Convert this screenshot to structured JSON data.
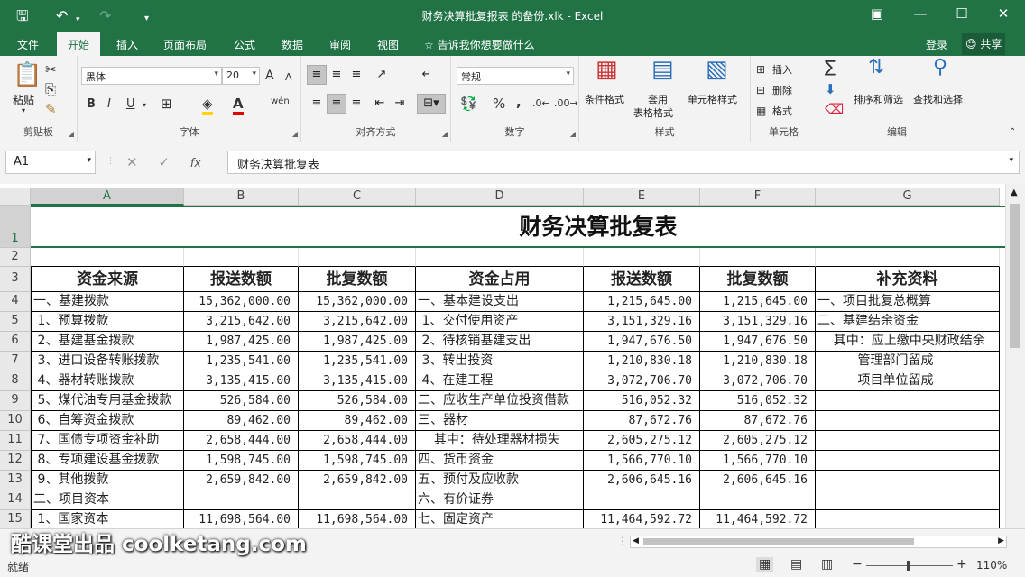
{
  "window": {
    "title": "财务决算批复报表 的备份.xlk - Excel"
  },
  "quick_access": {
    "save_icon": "save-icon",
    "undo_icon": "undo-icon",
    "redo_icon": "redo-icon",
    "customize_icon": "customize-icon"
  },
  "window_controls": {
    "restore_ribbon": "ribbon-display-icon",
    "min": "minimize-icon",
    "max": "maximize-icon",
    "close": "close-icon"
  },
  "tabs": [
    "文件",
    "开始",
    "插入",
    "页面布局",
    "公式",
    "数据",
    "审阅",
    "视图"
  ],
  "active_tab": "开始",
  "tell_me": "告诉我你想要做什么",
  "login": "登录",
  "share": "共享",
  "ribbon": {
    "clipboard": {
      "paste": "粘贴",
      "label": "剪贴板"
    },
    "font": {
      "name": "黑体",
      "size": "20",
      "bold": "B",
      "italic": "I",
      "underline": "U",
      "label": "字体",
      "grow": "A",
      "shrink": "A",
      "pinyin": "wén"
    },
    "alignment": {
      "label": "对齐方式"
    },
    "number": {
      "format": "常规",
      "label": "数字",
      "percent": "%",
      "comma": ","
    },
    "styles": {
      "cond": "条件格式",
      "table": "套用",
      "table2": "表格格式",
      "cell": "单元格样式",
      "label": "样式"
    },
    "cells": {
      "insert": "插入",
      "delete": "删除",
      "format": "格式",
      "label": "单元格"
    },
    "editing": {
      "sort": "排序和筛选",
      "find": "查找和选择",
      "label": "编辑"
    }
  },
  "formula_bar": {
    "name_box": "A1",
    "fx": "fx",
    "content": "财务决算批复表"
  },
  "columns": [
    "A",
    "B",
    "C",
    "D",
    "E",
    "F",
    "G"
  ],
  "rows": [
    "1",
    "2",
    "3",
    "4",
    "5",
    "6",
    "7",
    "8",
    "9",
    "10",
    "11",
    "12",
    "13",
    "14",
    "15"
  ],
  "sheet": {
    "title": "财务决算批复表",
    "headers": [
      "资金来源",
      "报送数额",
      "批复数额",
      "资金占用",
      "报送数额",
      "批复数额",
      "补充资料"
    ],
    "data": [
      [
        "一、基建拨款",
        "15,362,000.00",
        "15,362,000.00",
        "一、基本建设支出",
        "1,215,645.00",
        "1,215,645.00",
        "一、项目批复总概算"
      ],
      [
        " 1、预算拨款",
        "3,215,642.00",
        "3,215,642.00",
        " 1、交付使用资产",
        "3,151,329.16",
        "3,151,329.16",
        "二、基建结余资金"
      ],
      [
        " 2、基建基金拨款",
        "1,987,425.00",
        "1,987,425.00",
        " 2、待核销基建支出",
        "1,947,676.50",
        "1,947,676.50",
        "    其中：应上缴中央财政结余"
      ],
      [
        " 3、进口设备转账拨款",
        "1,235,541.00",
        "1,235,541.00",
        " 3、转出投资",
        "1,210,830.18",
        "1,210,830.18",
        "          管理部门留成"
      ],
      [
        " 4、器材转账拨款",
        "3,135,415.00",
        "3,135,415.00",
        " 4、在建工程",
        "3,072,706.70",
        "3,072,706.70",
        "          项目单位留成"
      ],
      [
        " 5、煤代油专用基金拨款",
        "526,584.00",
        "526,584.00",
        "二、应收生产单位投资借款",
        "516,052.32",
        "516,052.32",
        ""
      ],
      [
        " 6、自筹资金拨款",
        "89,462.00",
        "89,462.00",
        "三、器材",
        "87,672.76",
        "87,672.76",
        ""
      ],
      [
        " 7、国债专项资金补助",
        "2,658,444.00",
        "2,658,444.00",
        "    其中：待处理器材损失",
        "2,605,275.12",
        "2,605,275.12",
        ""
      ],
      [
        " 8、专项建设基金拨款",
        "1,598,745.00",
        "1,598,745.00",
        "四、货币资金",
        "1,566,770.10",
        "1,566,770.10",
        ""
      ],
      [
        " 9、其他拨款",
        "2,659,842.00",
        "2,659,842.00",
        "五、预付及应收款",
        "2,606,645.16",
        "2,606,645.16",
        ""
      ],
      [
        "二、项目资本",
        "",
        "",
        "六、有价证券",
        "",
        "",
        ""
      ],
      [
        " 1、国家资本",
        "11,698,564.00",
        "11,698,564.00",
        "七、固定资产",
        "11,464,592.72",
        "11,464,592.72",
        ""
      ]
    ]
  },
  "status": {
    "ready": "就绪",
    "zoom": "110%"
  },
  "watermark": "酷课堂出品 coolketang.com"
}
